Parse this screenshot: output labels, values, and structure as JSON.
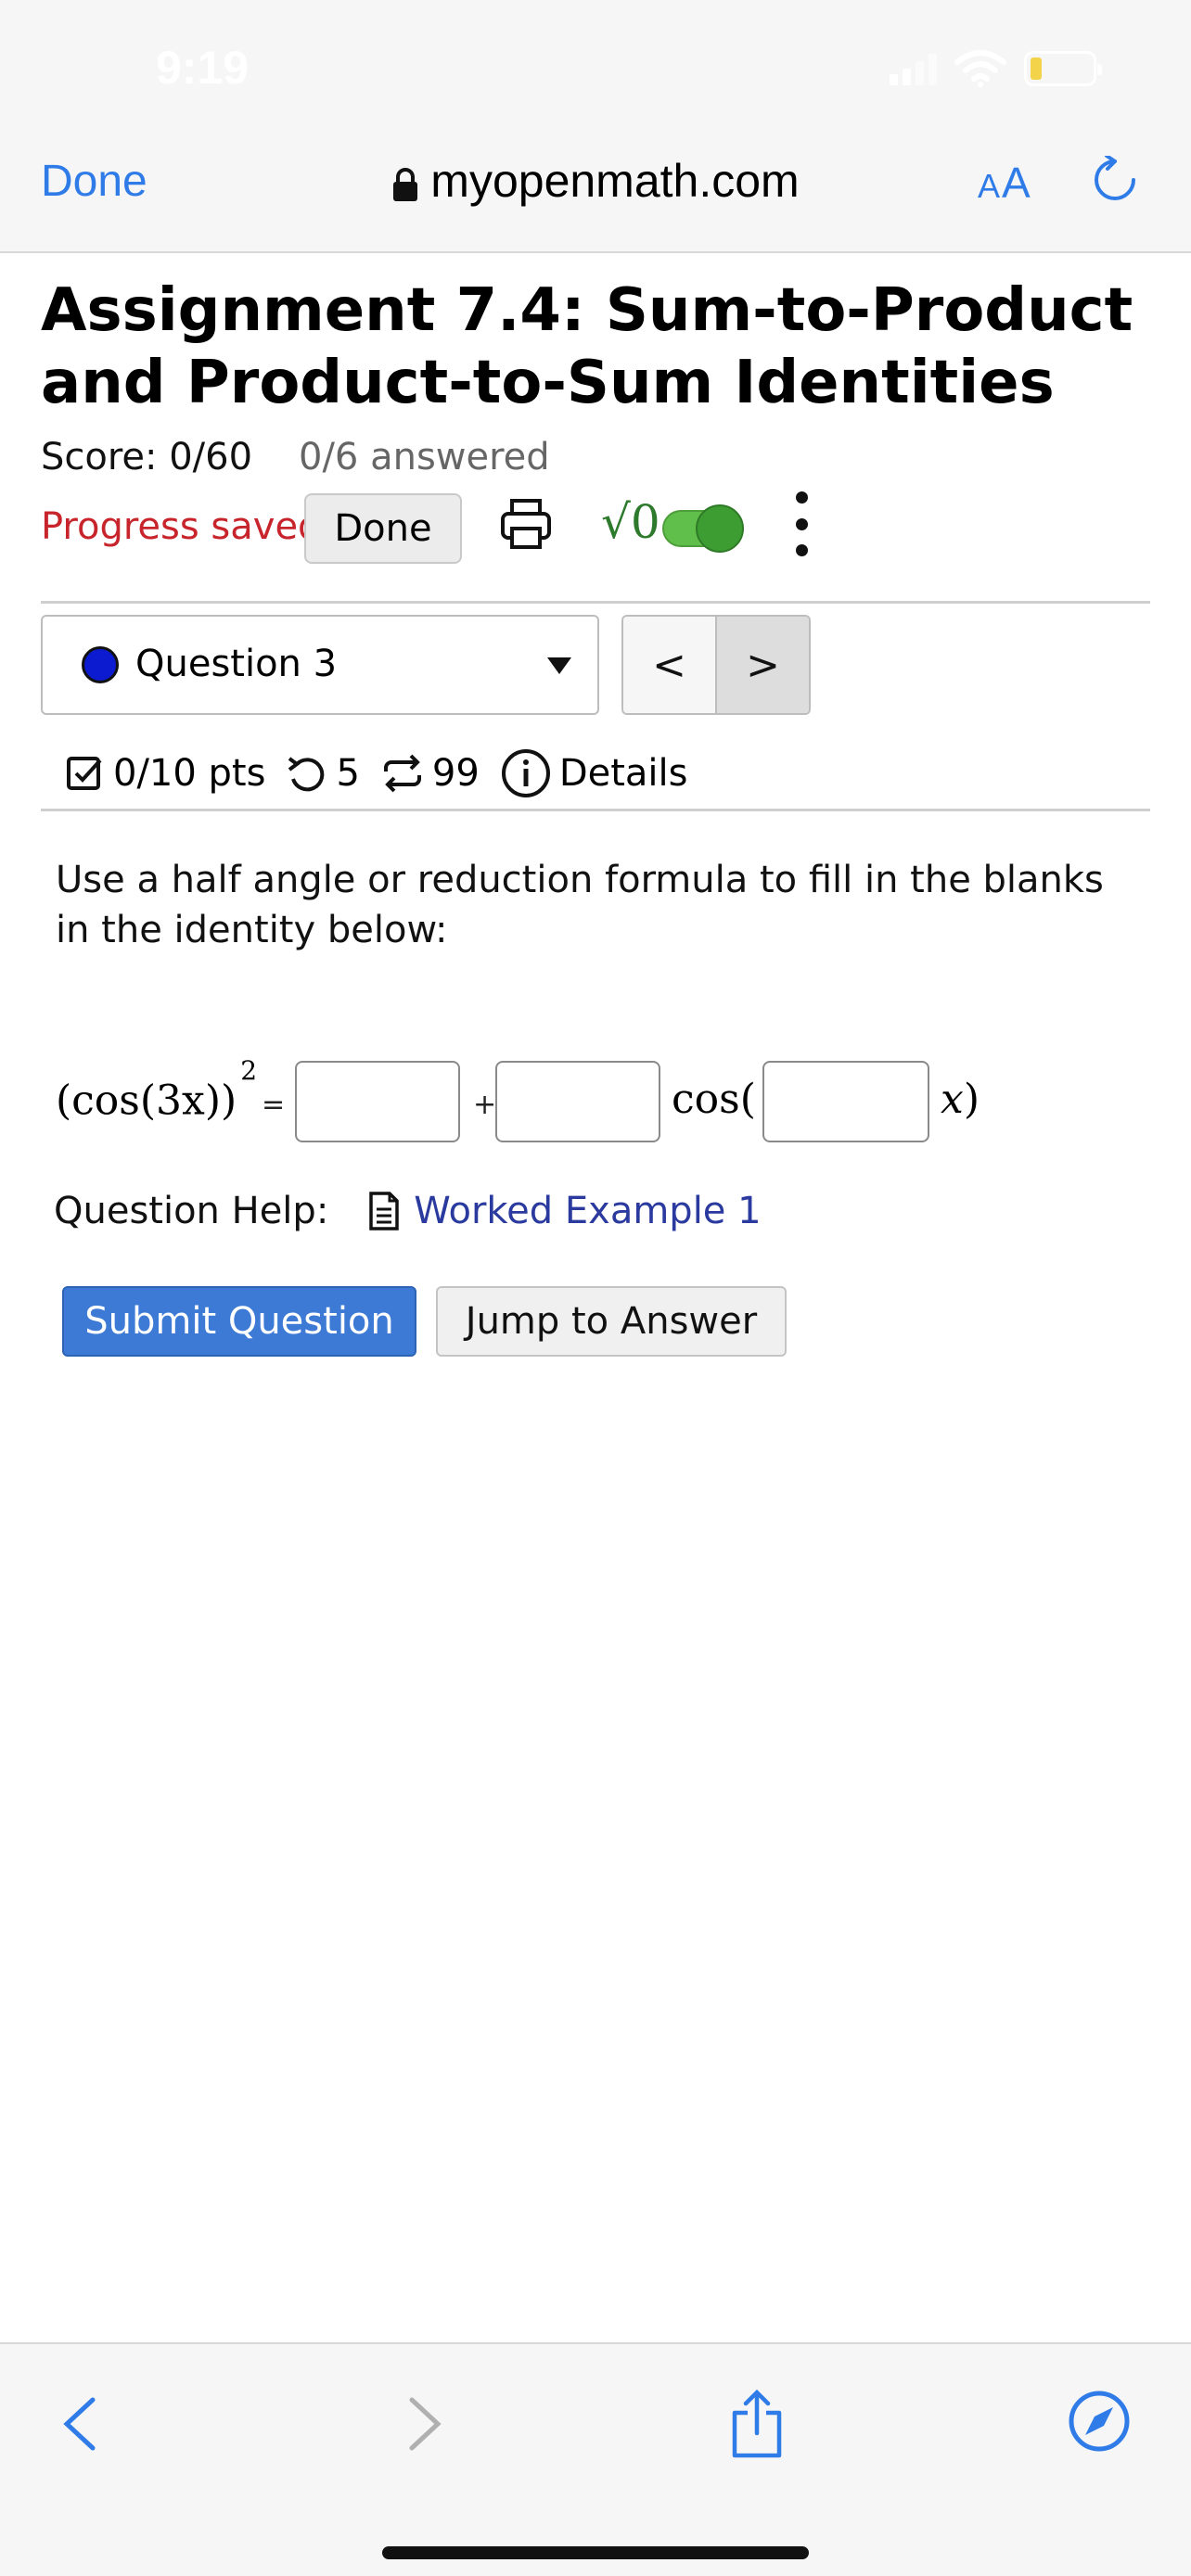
{
  "status_bar": {
    "time": "9:19"
  },
  "browser": {
    "done_label": "Done",
    "url": "myopenmath.com",
    "text_size_label_small": "A",
    "text_size_label_large": "A"
  },
  "assignment": {
    "title": "Assignment 7.4: Sum-to-Product and Product-to-Sum Identities",
    "score": "Score: 0/60",
    "answered": "0/6 answered",
    "progress_status": "Progress saved",
    "done_button": "Done",
    "sqrt_toggle_label": "√0"
  },
  "question_nav": {
    "current": "Question 3",
    "prev_label": "<",
    "next_label": ">"
  },
  "question_meta": {
    "points": "0/10 pts",
    "attempts": "5",
    "versions": "99",
    "details": "Details"
  },
  "question": {
    "prompt": "Use a half angle or reduction formula to fill in the blanks in the identity below:",
    "lhs": "(cos(3x))",
    "lhs_exponent": "2",
    "equals": "=",
    "plus": "+",
    "cos_open": "cos(",
    "x_var": "x",
    "close_paren": ")",
    "blank1_value": "",
    "blank2_value": "",
    "blank3_value": ""
  },
  "help": {
    "label": "Question Help:",
    "link": "Worked Example 1"
  },
  "actions": {
    "submit": "Submit Question",
    "jump": "Jump to Answer"
  },
  "colors": {
    "safari_blue": "#2f7ce8",
    "progress_red": "#c8242b",
    "submit_blue": "#3c7ad6",
    "toggle_green": "#5fbf4a",
    "question_dot": "#0c1bd0"
  },
  "icons": {
    "print": "printer-icon",
    "more": "vertical-ellipsis-icon",
    "points": "checkbox-icon",
    "attempts": "undo-icon",
    "versions": "repeat-icon",
    "details": "info-icon",
    "doc": "document-icon"
  }
}
